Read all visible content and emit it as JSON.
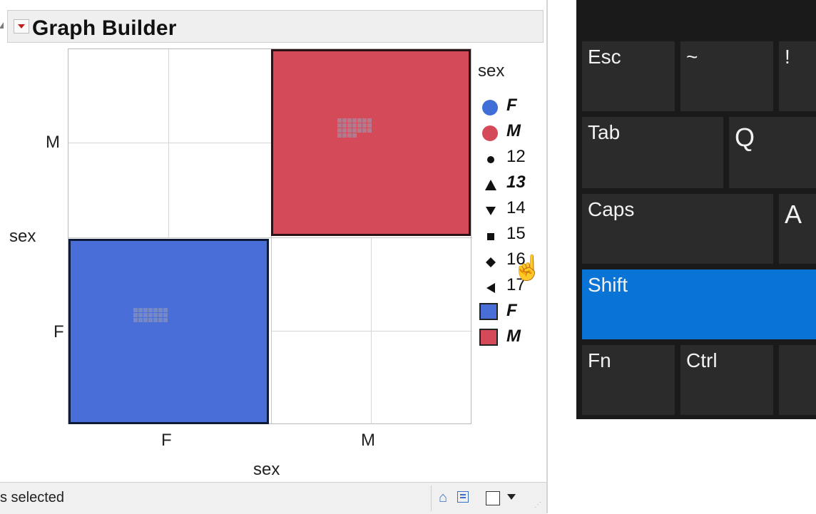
{
  "header": {
    "title": "Graph Builder"
  },
  "graph": {
    "y_axis_title": "sex",
    "x_axis_title": "sex",
    "y_ticks": [
      "M",
      "F"
    ],
    "x_ticks": [
      "F",
      "M"
    ]
  },
  "legend": {
    "title": "sex",
    "items": [
      {
        "label": "F",
        "marker": "circle",
        "color": "#3f6fd6",
        "style": "bold-italic"
      },
      {
        "label": "M",
        "marker": "circle",
        "color": "#d44a58",
        "style": "bold-italic"
      },
      {
        "label": "12",
        "marker": "filled-circle",
        "style": "normal"
      },
      {
        "label": "13",
        "marker": "up-triangle",
        "style": "bold-italic"
      },
      {
        "label": "14",
        "marker": "down-triangle",
        "style": "normal"
      },
      {
        "label": "15",
        "marker": "square",
        "style": "normal"
      },
      {
        "label": "16",
        "marker": "diamond",
        "style": "normal"
      },
      {
        "label": "17",
        "marker": "left-triangle",
        "style": "normal"
      },
      {
        "label": "F",
        "marker": "box",
        "color": "#3f6fd6",
        "style": "bold-italic"
      },
      {
        "label": "M",
        "marker": "box",
        "color": "#d44a58",
        "style": "bold-italic"
      }
    ]
  },
  "status_bar": {
    "text": "s selected"
  },
  "keyboard": {
    "keys": {
      "esc": "Esc",
      "tilde": "~",
      "excl": "!",
      "tab": "Tab",
      "q": "Q",
      "caps": "Caps",
      "a": "A",
      "shift": "Shift",
      "fn": "Fn",
      "ctrl": "Ctrl"
    },
    "active_key": "Shift",
    "active_color": "#0a74d6"
  },
  "colors": {
    "female": "#4a6ed8",
    "male": "#d44a58"
  }
}
